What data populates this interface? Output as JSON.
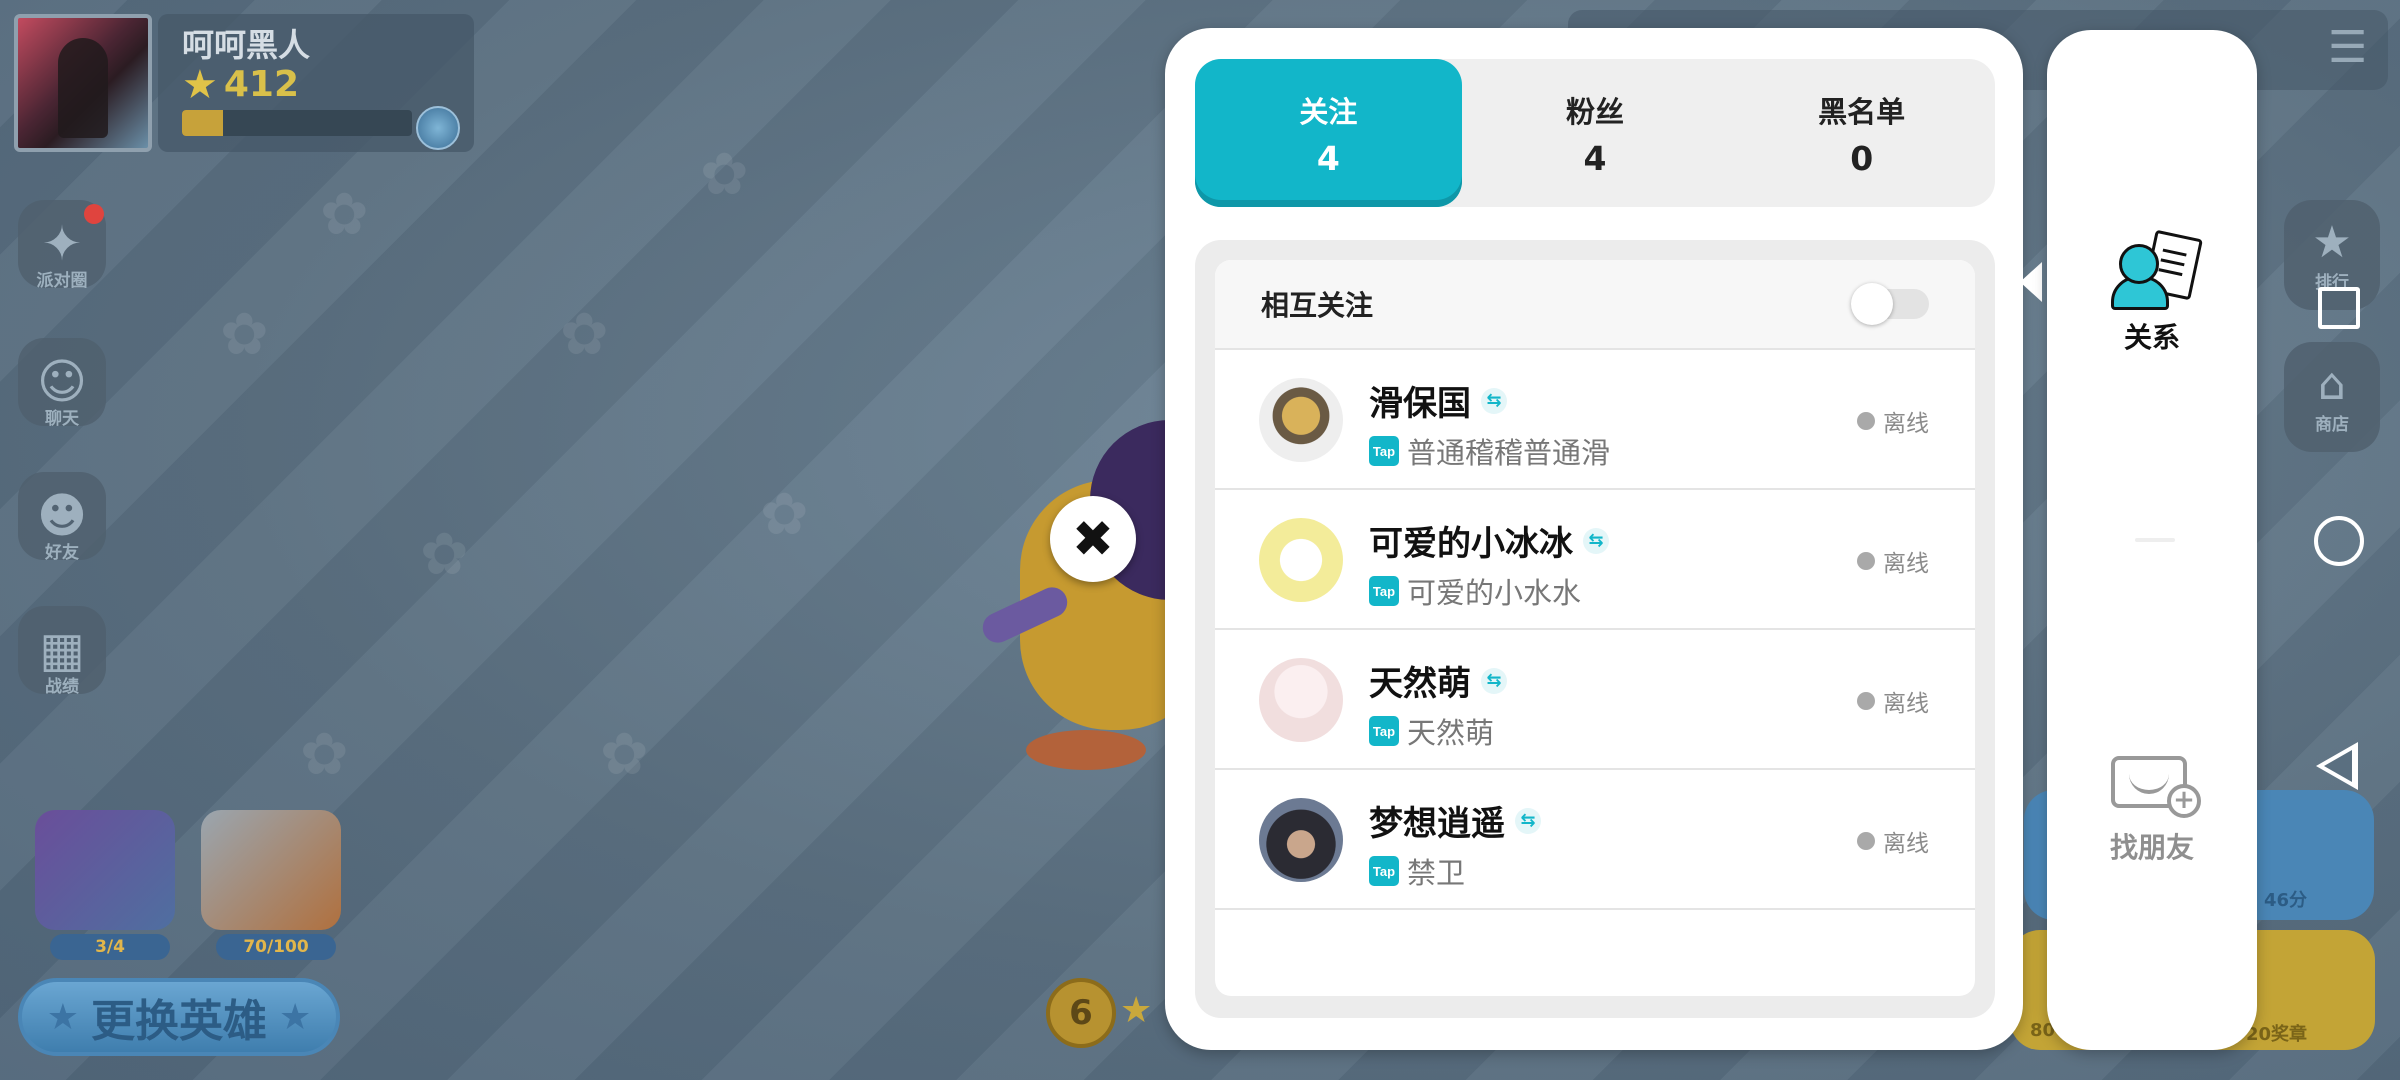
{
  "player": {
    "name": "呵呵黑人",
    "stars": "412",
    "xp_fraction": 0.18
  },
  "left_menu": [
    {
      "label": "派对圈",
      "icon": "party-popper-icon",
      "badge": true
    },
    {
      "label": "聊天",
      "icon": "chat-icon",
      "badge": false
    },
    {
      "label": "好友",
      "icon": "friends-icon",
      "badge": false
    },
    {
      "label": "战绩",
      "icon": "film-icon",
      "badge": false
    }
  ],
  "chests": [
    {
      "progress": "3/4"
    },
    {
      "progress": "70/100"
    }
  ],
  "swap_hero_label": "更换英雄",
  "level_badge": "6",
  "right_menu": [
    {
      "label": "排行",
      "icon": "stars-icon"
    },
    {
      "label": "商店",
      "icon": "shop-icon"
    }
  ],
  "play_blue_sub": "46分",
  "play_yellow_sub": "20奖章",
  "play_yellow_left": "80",
  "tabs": [
    {
      "label": "关注",
      "count": "4",
      "active": true
    },
    {
      "label": "粉丝",
      "count": "4",
      "active": false
    },
    {
      "label": "黑名单",
      "count": "0",
      "active": false
    }
  ],
  "mutual_follow_label": "相互关注",
  "mutual_follow_on": false,
  "friends": [
    {
      "name": "滑保国",
      "tap_name": "普通稽稽普通滑",
      "status": "离线"
    },
    {
      "name": "可爱的小冰冰",
      "tap_name": "可爱的小水水",
      "status": "离线"
    },
    {
      "name": "天然萌",
      "tap_name": "天然萌",
      "status": "离线"
    },
    {
      "name": "梦想逍遥",
      "tap_name": "禁卫",
      "status": "离线"
    }
  ],
  "tap_badge": "Tap",
  "side_panel": {
    "relations_label": "关系",
    "find_friends_label": "找朋友"
  },
  "colors": {
    "accent": "#12b6c9",
    "offline_dot": "#a9a9a9"
  }
}
